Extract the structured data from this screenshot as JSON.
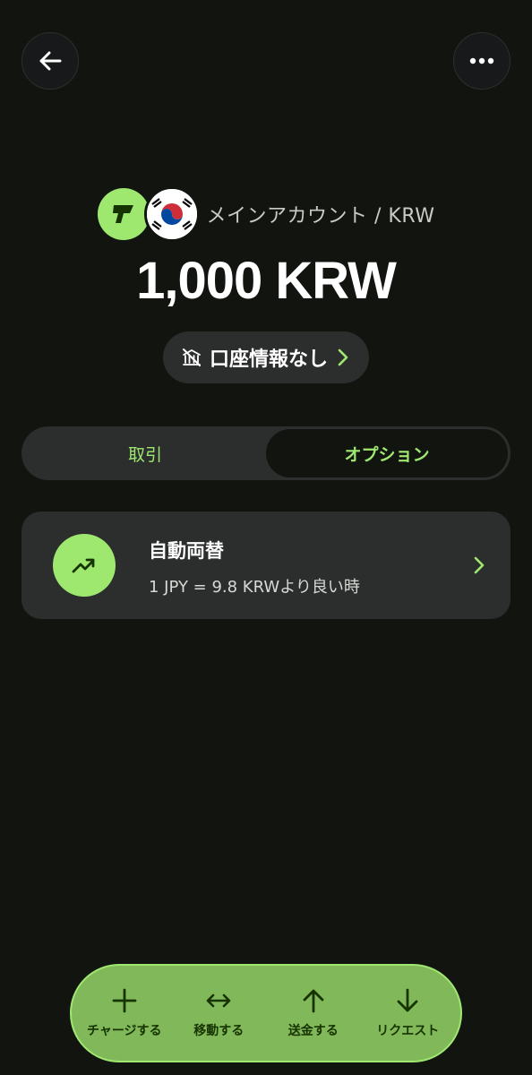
{
  "header": {
    "account_name": "メインアカウント / KRW",
    "balance": "1,000 KRW",
    "account_info_label": "口座情報なし"
  },
  "tabs": [
    {
      "label": "取引",
      "active": false
    },
    {
      "label": "オプション",
      "active": true
    }
  ],
  "option_card": {
    "title": "自動両替",
    "subtitle": "1 JPY = 9.8 KRWより良い時"
  },
  "actions": [
    {
      "label": "チャージする",
      "icon": "plus-icon"
    },
    {
      "label": "移動する",
      "icon": "swap-arrows-icon"
    },
    {
      "label": "送金する",
      "icon": "arrow-up-icon"
    },
    {
      "label": "リクエスト",
      "icon": "arrow-down-icon"
    }
  ],
  "colors": {
    "background": "#121410",
    "accent": "#9fe870",
    "card": "#2c2e2d",
    "action_bar": "#80b85a",
    "action_text": "#163300"
  }
}
